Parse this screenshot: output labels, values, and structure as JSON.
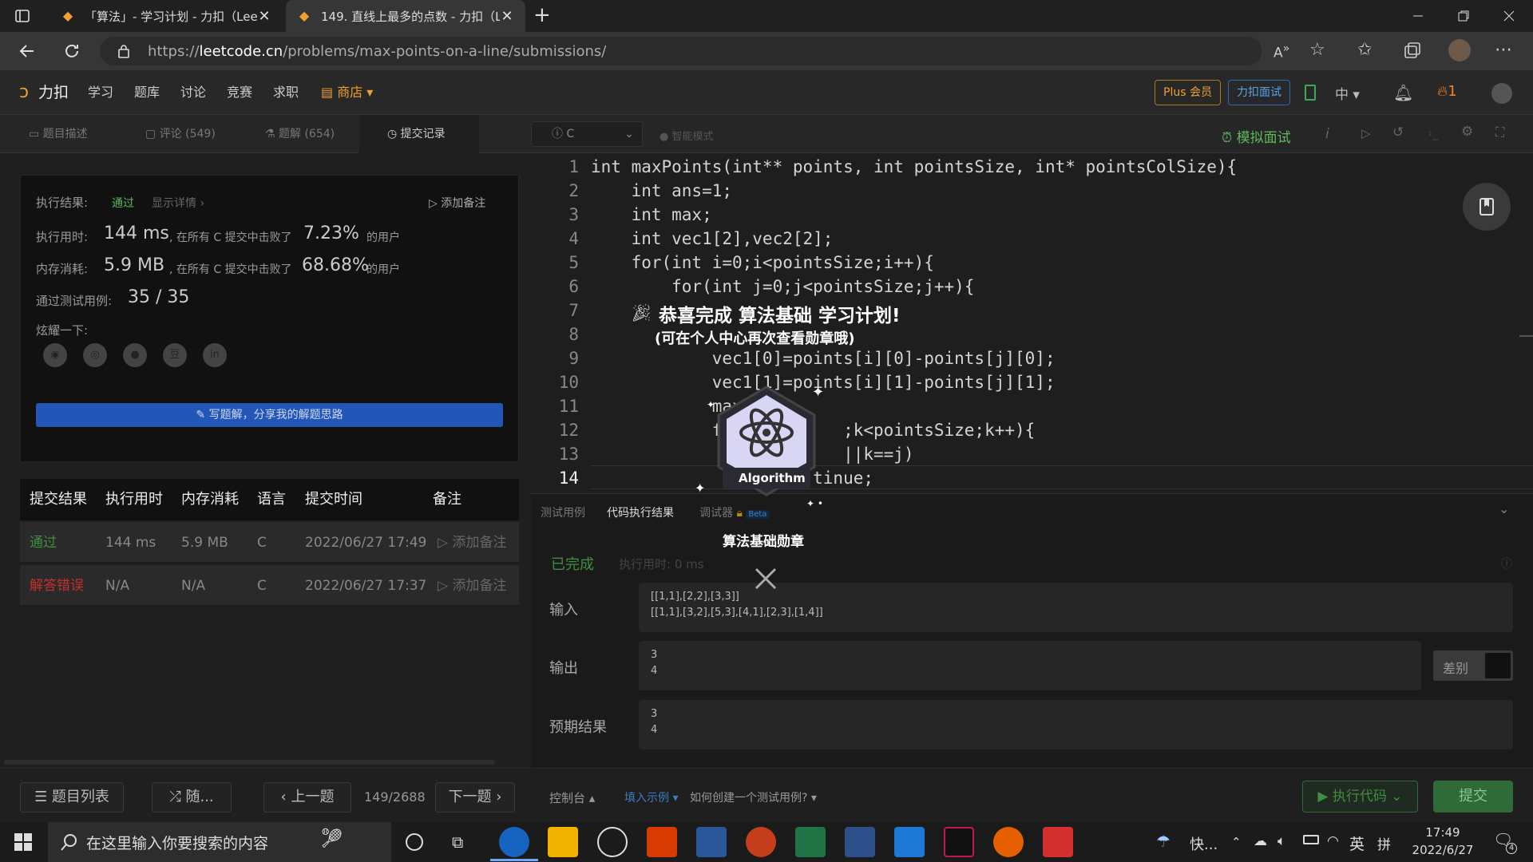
{
  "browser": {
    "tabs": [
      {
        "title": "「算法」- 学习计划 - 力扣（Lee",
        "active": false
      },
      {
        "title": "149. 直线上最多的点数 - 力扣（L",
        "active": true
      }
    ],
    "new_tab": "+",
    "url_prefix": "https://",
    "url_domain": "leetcode.cn",
    "url_path": "/problems/max-points-on-a-line/submissions/"
  },
  "site_nav": {
    "logo": "力扣",
    "links": [
      "学习",
      "题库",
      "讨论",
      "竞赛",
      "求职"
    ],
    "store": "商店",
    "plus": "Plus 会员",
    "interview": "力扣面试",
    "lang": "中",
    "streak": "1"
  },
  "problem_tabs": [
    {
      "label": "题目描述",
      "icon": "doc-icon"
    },
    {
      "label": "评论 (549)",
      "icon": "comment-icon"
    },
    {
      "label": "题解 (654)",
      "icon": "flask-icon"
    },
    {
      "label": "提交记录",
      "icon": "clock-icon"
    }
  ],
  "result": {
    "status_label": "执行结果:",
    "status": "通过",
    "details": "显示详情 ›",
    "add_note": "添加备注",
    "time_label": "执行用时:",
    "time": "144 ms",
    "time_mid": ", 在所有 C 提交中击败了",
    "time_pct": "7.23%",
    "users": "的用户",
    "mem_label": "内存消耗:",
    "mem": "5.9 MB",
    "mem_mid": ", 在所有 C 提交中击败了",
    "mem_pct": "68.68%",
    "cases_label": "通过测试用例:",
    "cases": "35 / 35",
    "share_label": "炫耀一下:",
    "share_icons": [
      "wechat-icon",
      "weibo-icon",
      "qq-icon",
      "douban-icon",
      "linkedin-icon"
    ],
    "write_solution": "写题解，分享我的解题思路"
  },
  "submissions": {
    "headers": [
      "提交结果",
      "执行用时",
      "内存消耗",
      "语言",
      "提交时间",
      "备注"
    ],
    "rows": [
      {
        "result": "通过",
        "time": "144 ms",
        "mem": "5.9 MB",
        "lang": "C",
        "date": "2022/06/27 17:49",
        "note": "添加备注",
        "color": "#3f8f3f"
      },
      {
        "result": "解答错误",
        "time": "N/A",
        "mem": "N/A",
        "lang": "C",
        "date": "2022/06/27 17:37",
        "note": "添加备注",
        "color": "#c33030"
      }
    ]
  },
  "left_footer": {
    "problem_list": "题目列表",
    "random": "随...",
    "prev": "上一题",
    "pager": "149/2688",
    "next": "下一题"
  },
  "editor": {
    "language": "C",
    "smart_mode": "智能模式",
    "mock": "模拟面试",
    "lines": [
      "int maxPoints(int** points, int pointsSize, int* pointsColSize){",
      "    int ans=1;",
      "    int max;",
      "    int vec1[2],vec2[2];",
      "    for(int i=0;i<pointsSize;i++){",
      "        for(int j=0;j<pointsSize;j++){",
      "",
      "",
      "            vec1[0]=points[i][0]-points[j][0];",
      "            vec1[1]=points[i][1]-points[j][1];",
      "            max",
      "            f            ;k<pointsSize;k++){",
      "                         ||k==j)",
      "                      tinue;"
    ]
  },
  "console": {
    "tabs": [
      "测试用例",
      "代码执行结果",
      "调试器",
      "Beta"
    ],
    "status": "已完成",
    "exec_time": "执行用时: 0 ms",
    "input_label": "输入",
    "input_lines": [
      "[[1,1],[2,2],[3,3]]",
      "[[1,1],[3,2],[5,3],[4,1],[2,3],[1,4]]"
    ],
    "output_label": "输出",
    "output_lines": [
      "3",
      "4"
    ],
    "diff": "差别",
    "expected_label": "预期结果",
    "expected_lines": [
      "3",
      "4"
    ],
    "console_btn": "控制台 ▴",
    "fill_example": "填入示例 ▾",
    "how_to": "如何创建一个测试用例? ▾",
    "run": "执行代码",
    "submit": "提交"
  },
  "popup": {
    "title": "恭喜完成 算法基础 学习计划!",
    "subtitle": "(可在个人中心再次查看勋章哦)",
    "badge_label": "Algorithm",
    "badge_name": "算法基础勋章"
  },
  "taskbar": {
    "search_placeholder": "在这里输入你要搜索的内容",
    "apps": [
      "edge-icon",
      "folder-icon",
      "dell-icon",
      "office-icon",
      "word-icon",
      "powerpoint-icon",
      "excel-icon",
      "devcpp-icon",
      "photos-icon",
      "intellij-icon",
      "firefox-icon",
      "wps-icon"
    ],
    "weather": "快...",
    "ime_lang": "英",
    "ime_mode": "拼",
    "time": "17:49",
    "date": "2022/6/27",
    "notifications": "4"
  }
}
